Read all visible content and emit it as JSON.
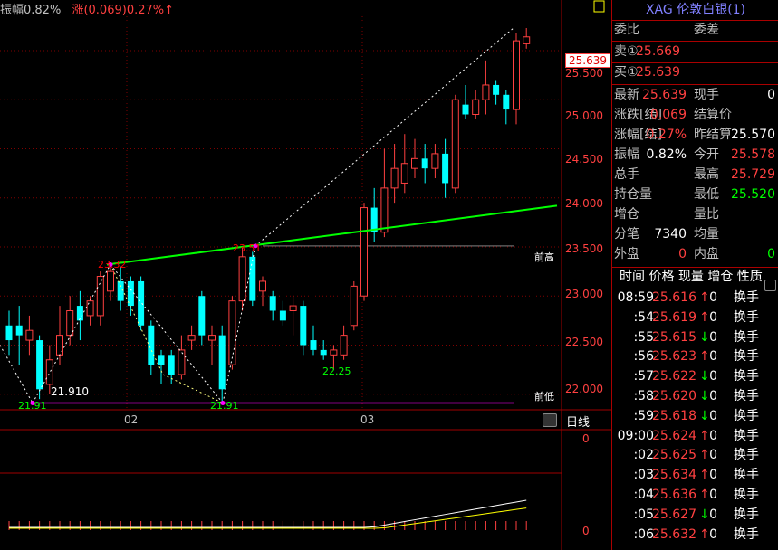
{
  "header": {
    "amplitude": "振幅0.82%",
    "change": "涨(0.069)0.27%↑"
  },
  "chart": {
    "y_ticks": [
      "25.500",
      "25.000",
      "24.500",
      "24.000",
      "23.500",
      "23.000",
      "22.500",
      "22.000"
    ],
    "price_tag": "25.639",
    "x_labels": [
      "02",
      "03"
    ],
    "period": "日线",
    "prev_high_label": "前高",
    "prev_low_label": "前低",
    "low_value_label": "21.910",
    "point_labels": [
      "21.91",
      "21.91",
      "22.25",
      "23.32",
      "23.51"
    ],
    "sub_zero_1": "0",
    "sub_zero_2": "0",
    "colors": {
      "up": "#ff4040",
      "down": "#00ffff",
      "trend": "#00ff00",
      "low_line": "#ff00ff"
    }
  },
  "chart_data": {
    "type": "candlestick",
    "ylim": [
      21.85,
      25.85
    ],
    "candles": [
      {
        "o": 22.7,
        "c": 22.55,
        "h": 22.85,
        "l": 22.4
      },
      {
        "o": 22.7,
        "c": 22.6,
        "h": 22.9,
        "l": 22.3
      },
      {
        "o": 22.55,
        "c": 22.65,
        "h": 22.8,
        "l": 22.4
      },
      {
        "o": 22.55,
        "c": 22.05,
        "h": 22.6,
        "l": 21.95
      },
      {
        "o": 22.1,
        "c": 22.35,
        "h": 22.5,
        "l": 22.0
      },
      {
        "o": 22.4,
        "c": 22.6,
        "h": 22.9,
        "l": 22.3
      },
      {
        "o": 22.6,
        "c": 22.85,
        "h": 23.0,
        "l": 22.5
      },
      {
        "o": 22.9,
        "c": 22.75,
        "h": 23.05,
        "l": 22.55
      },
      {
        "o": 22.8,
        "c": 22.95,
        "h": 23.0,
        "l": 22.7
      },
      {
        "o": 22.8,
        "c": 23.2,
        "h": 23.25,
        "l": 22.7
      },
      {
        "o": 23.05,
        "c": 23.25,
        "h": 23.32,
        "l": 22.95
      },
      {
        "o": 23.15,
        "c": 22.95,
        "h": 23.3,
        "l": 22.85
      },
      {
        "o": 23.15,
        "c": 22.9,
        "h": 23.2,
        "l": 22.8
      },
      {
        "o": 23.15,
        "c": 22.7,
        "h": 23.2,
        "l": 22.65
      },
      {
        "o": 22.7,
        "c": 22.3,
        "h": 22.75,
        "l": 22.2
      },
      {
        "o": 22.4,
        "c": 22.3,
        "h": 22.45,
        "l": 22.1
      },
      {
        "o": 22.4,
        "c": 22.2,
        "h": 22.45,
        "l": 22.1
      },
      {
        "o": 22.2,
        "c": 22.45,
        "h": 22.6,
        "l": 22.15
      },
      {
        "o": 22.55,
        "c": 22.6,
        "h": 22.7,
        "l": 22.45
      },
      {
        "o": 23.0,
        "c": 22.6,
        "h": 23.05,
        "l": 22.5
      },
      {
        "o": 22.55,
        "c": 22.6,
        "h": 22.7,
        "l": 22.3
      },
      {
        "o": 22.6,
        "c": 22.05,
        "h": 22.7,
        "l": 21.91
      },
      {
        "o": 22.3,
        "c": 22.95,
        "h": 23.0,
        "l": 22.25
      },
      {
        "o": 22.95,
        "c": 23.4,
        "h": 23.51,
        "l": 22.85
      },
      {
        "o": 23.4,
        "c": 22.95,
        "h": 23.45,
        "l": 22.9
      },
      {
        "o": 23.05,
        "c": 23.15,
        "h": 23.2,
        "l": 22.9
      },
      {
        "o": 23.0,
        "c": 22.85,
        "h": 23.05,
        "l": 22.75
      },
      {
        "o": 22.85,
        "c": 22.75,
        "h": 22.95,
        "l": 22.7
      },
      {
        "o": 22.85,
        "c": 22.9,
        "h": 23.0,
        "l": 22.6
      },
      {
        "o": 22.9,
        "c": 22.5,
        "h": 22.95,
        "l": 22.4
      },
      {
        "o": 22.55,
        "c": 22.45,
        "h": 22.7,
        "l": 22.4
      },
      {
        "o": 22.45,
        "c": 22.4,
        "h": 22.55,
        "l": 22.35
      },
      {
        "o": 22.4,
        "c": 22.45,
        "h": 22.5,
        "l": 22.25
      },
      {
        "o": 22.4,
        "c": 22.6,
        "h": 22.7,
        "l": 22.35
      },
      {
        "o": 22.7,
        "c": 23.1,
        "h": 23.15,
        "l": 22.65
      },
      {
        "o": 23.0,
        "c": 23.9,
        "h": 23.95,
        "l": 22.95
      },
      {
        "o": 23.9,
        "c": 23.65,
        "h": 24.1,
        "l": 23.55
      },
      {
        "o": 23.65,
        "c": 24.1,
        "h": 24.5,
        "l": 23.6
      },
      {
        "o": 24.1,
        "c": 24.3,
        "h": 24.55,
        "l": 23.95
      },
      {
        "o": 24.15,
        "c": 24.35,
        "h": 24.65,
        "l": 24.05
      },
      {
        "o": 24.3,
        "c": 24.4,
        "h": 24.6,
        "l": 24.2
      },
      {
        "o": 24.4,
        "c": 24.3,
        "h": 24.55,
        "l": 24.15
      },
      {
        "o": 24.3,
        "c": 24.45,
        "h": 24.55,
        "l": 24.2
      },
      {
        "o": 24.45,
        "c": 24.15,
        "h": 24.6,
        "l": 24.0
      },
      {
        "o": 24.1,
        "c": 25.0,
        "h": 25.05,
        "l": 24.05
      },
      {
        "o": 24.95,
        "c": 24.85,
        "h": 25.15,
        "l": 24.8
      },
      {
        "o": 24.85,
        "c": 25.0,
        "h": 25.1,
        "l": 24.8
      },
      {
        "o": 25.0,
        "c": 25.15,
        "h": 25.4,
        "l": 24.85
      },
      {
        "o": 25.15,
        "c": 25.05,
        "h": 25.2,
        "l": 24.95
      },
      {
        "o": 25.05,
        "c": 24.9,
        "h": 25.1,
        "l": 24.75
      },
      {
        "o": 24.9,
        "c": 25.6,
        "h": 25.68,
        "l": 24.75
      },
      {
        "o": 25.57,
        "c": 25.64,
        "h": 25.73,
        "l": 25.52
      }
    ]
  },
  "panel": {
    "title": "XAG 伦敦白银(1)",
    "weibi_label": "委比",
    "weicha_label": "委差",
    "sell_label": "卖①",
    "sell_price": "25.669",
    "buy_label": "买①",
    "buy_price": "25.639",
    "rows": [
      {
        "l1": "最新",
        "v1": "25.639",
        "c1": "red",
        "l2": "现手",
        "v2": "0",
        "c2": "white"
      },
      {
        "l1": "涨跌[结]",
        "v1": "0.069",
        "c1": "red",
        "l2": "结算价",
        "v2": "",
        "c2": "white"
      },
      {
        "l1": "涨幅[结]",
        "v1": "0.27%",
        "c1": "red",
        "l2": "昨结算",
        "v2": "25.570",
        "c2": "white"
      },
      {
        "l1": "振幅",
        "v1": "0.82%",
        "c1": "white",
        "l2": "今开",
        "v2": "25.578",
        "c2": "red"
      },
      {
        "l1": "总手",
        "v1": "",
        "c1": "white",
        "l2": "最高",
        "v2": "25.729",
        "c2": "red"
      },
      {
        "l1": "持仓量",
        "v1": "",
        "c1": "white",
        "l2": "最低",
        "v2": "25.520",
        "c2": "green"
      },
      {
        "l1": "增仓",
        "v1": "",
        "c1": "white",
        "l2": "量比",
        "v2": "",
        "c2": "white"
      },
      {
        "l1": "分笔",
        "v1": "7340",
        "c1": "white",
        "l2": "均量",
        "v2": "",
        "c2": "white"
      },
      {
        "l1": "外盘",
        "v1": "0",
        "c1": "red",
        "l2": "内盘",
        "v2": "0",
        "c2": "green"
      }
    ],
    "trade_header": "时间 价格 现量 增仓 性质",
    "trades": [
      {
        "time": "08:59",
        "price": "25.616",
        "arrow": "↑",
        "ac": "red",
        "vol": "0",
        "type": "换手"
      },
      {
        "time": ":54",
        "price": "25.619",
        "arrow": "↑",
        "ac": "red",
        "vol": "0",
        "type": "换手"
      },
      {
        "time": ":55",
        "price": "25.615",
        "arrow": "↓",
        "ac": "green",
        "vol": "0",
        "type": "换手"
      },
      {
        "time": ":56",
        "price": "25.623",
        "arrow": "↑",
        "ac": "red",
        "vol": "0",
        "type": "换手"
      },
      {
        "time": ":57",
        "price": "25.622",
        "arrow": "↓",
        "ac": "green",
        "vol": "0",
        "type": "换手"
      },
      {
        "time": ":58",
        "price": "25.620",
        "arrow": "↓",
        "ac": "green",
        "vol": "0",
        "type": "换手"
      },
      {
        "time": ":59",
        "price": "25.618",
        "arrow": "↓",
        "ac": "green",
        "vol": "0",
        "type": "换手"
      },
      {
        "time": "09:00",
        "price": "25.624",
        "arrow": "↑",
        "ac": "red",
        "vol": "0",
        "type": "换手"
      },
      {
        "time": ":02",
        "price": "25.625",
        "arrow": "↑",
        "ac": "red",
        "vol": "0",
        "type": "换手"
      },
      {
        "time": ":03",
        "price": "25.634",
        "arrow": "↑",
        "ac": "red",
        "vol": "0",
        "type": "换手"
      },
      {
        "time": ":04",
        "price": "25.636",
        "arrow": "↑",
        "ac": "red",
        "vol": "0",
        "type": "换手"
      },
      {
        "time": ":05",
        "price": "25.627",
        "arrow": "↓",
        "ac": "green",
        "vol": "0",
        "type": "换手"
      },
      {
        "time": ":06",
        "price": "25.632",
        "arrow": "↑",
        "ac": "red",
        "vol": "0",
        "type": "换手"
      }
    ]
  }
}
